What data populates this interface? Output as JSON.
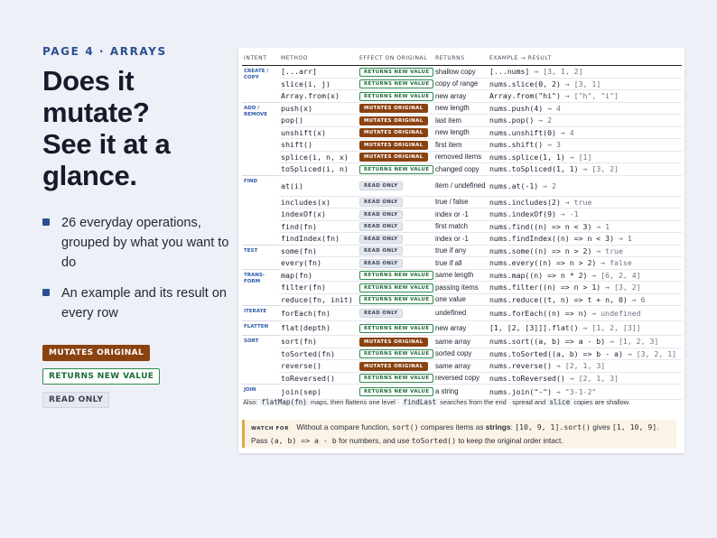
{
  "eyebrow": "PAGE 4 · ARRAYS",
  "title_lines": [
    "Does it mutate?",
    "See it at a",
    "glance."
  ],
  "bullets": [
    "26 everyday operations, grouped by what you want to do",
    "An example and its result on every row"
  ],
  "legend": {
    "mutates": "MUTATES ORIGINAL",
    "new_value": "RETURNS NEW VALUE",
    "read_only": "READ ONLY"
  },
  "colors": {
    "accent": "#2b4f92",
    "mutates": "#8a4210",
    "new_value": "#2f8a4f",
    "read_only": "#e3e7ef",
    "watch_border": "#e0a842",
    "watch_bg": "#fbf3e6"
  },
  "table": {
    "headers": [
      "INTENT",
      "METHOD",
      "EFFECT ON ORIGINAL",
      "RETURNS",
      "EXAMPLE → RESULT"
    ],
    "groups": [
      {
        "label": "CREATE / COPY",
        "rows": [
          {
            "method": "[...arr]",
            "effect": "new",
            "returns": "shallow copy",
            "example": "[...nums]",
            "result": "→ [3, 1, 2]"
          },
          {
            "method": "slice(i, j)",
            "effect": "new",
            "returns": "copy of range",
            "example": "nums.slice(0, 2)",
            "result": "→ [3, 1]"
          },
          {
            "method": "Array.from(x)",
            "effect": "new",
            "returns": "new array",
            "example": "Array.from(\"hi\")",
            "result": "→ [\"h\", \"i\"]"
          }
        ]
      },
      {
        "label": "ADD / REMOVE",
        "rows": [
          {
            "method": "push(x)",
            "effect": "mut",
            "returns": "new length",
            "example": "nums.push(4)",
            "result": "→ 4"
          },
          {
            "method": "pop()",
            "effect": "mut",
            "returns": "last item",
            "example": "nums.pop()",
            "result": "→ 2"
          },
          {
            "method": "unshift(x)",
            "effect": "mut",
            "returns": "new length",
            "example": "nums.unshift(0)",
            "result": "→ 4"
          },
          {
            "method": "shift()",
            "effect": "mut",
            "returns": "first item",
            "example": "nums.shift()",
            "result": "→ 3"
          },
          {
            "method": "splice(i, n, x)",
            "effect": "mut",
            "returns": "removed items",
            "example": "nums.splice(1, 1)",
            "result": "→ [1]"
          },
          {
            "method": "toSpliced(i, n)",
            "effect": "new",
            "returns": "changed copy",
            "example": "nums.toSpliced(1, 1)",
            "result": "→ [3, 2]"
          }
        ]
      },
      {
        "label": "FIND",
        "rows": [
          {
            "method": "at(i)",
            "effect": "ro",
            "returns": "item / undefined",
            "example": "nums.at(-1)",
            "result": "→ 2",
            "tall": true
          },
          {
            "method": "includes(x)",
            "effect": "ro",
            "returns": "true / false",
            "example": "nums.includes(2)",
            "result": "→ true"
          },
          {
            "method": "indexOf(x)",
            "effect": "ro",
            "returns": "index or -1",
            "example": "nums.indexOf(9)",
            "result": "→ -1"
          },
          {
            "method": "find(fn)",
            "effect": "ro",
            "returns": "first match",
            "example": "nums.find((n) => n < 3)",
            "result": "→ 1"
          },
          {
            "method": "findIndex(fn)",
            "effect": "ro",
            "returns": "index or -1",
            "example": "nums.findIndex((n) => n < 3)",
            "result": "→ 1"
          }
        ]
      },
      {
        "label": "TEST",
        "rows": [
          {
            "method": "some(fn)",
            "effect": "ro",
            "returns": "true if any",
            "example": "nums.some((n) => n > 2)",
            "result": "→ true"
          },
          {
            "method": "every(fn)",
            "effect": "ro",
            "returns": "true if all",
            "example": "nums.every((n) => n > 2)",
            "result": "→ false"
          }
        ]
      },
      {
        "label": "TRANS- FORM",
        "rows": [
          {
            "method": "map(fn)",
            "effect": "new",
            "returns": "same length",
            "example": "nums.map((n) => n * 2)",
            "result": "→ [6, 2, 4]"
          },
          {
            "method": "filter(fn)",
            "effect": "new",
            "returns": "passing items",
            "example": "nums.filter((n) => n > 1)",
            "result": "→ [3, 2]"
          },
          {
            "method": "reduce(fn, init)",
            "effect": "new",
            "returns": "one value",
            "example": "nums.reduce((t, n) => t + n, 0)",
            "result": "→ 6"
          }
        ]
      },
      {
        "label": "ITERATE",
        "rows": [
          {
            "method": "forEach(fn)",
            "effect": "ro",
            "returns": "undefined",
            "example": "nums.forEach((n) => n)",
            "result": "→ undefined"
          }
        ]
      },
      {
        "label": "FLATTEN",
        "rows": [
          {
            "method": "flat(depth)",
            "effect": "new",
            "returns": "new array",
            "example": "[1, [2, [3]]].flat()",
            "result": "→ [1, 2, [3]]"
          }
        ]
      },
      {
        "label": "SORT",
        "rows": [
          {
            "method": "sort(fn)",
            "effect": "mut",
            "returns": "same array",
            "example": "nums.sort((a, b) => a - b)",
            "result": "→ [1, 2, 3]"
          },
          {
            "method": "toSorted(fn)",
            "effect": "new",
            "returns": "sorted copy",
            "example": "nums.toSorted((a, b) => b - a)",
            "result": "→ [3, 2, 1]"
          },
          {
            "method": "reverse()",
            "effect": "mut",
            "returns": "same array",
            "example": "nums.reverse()",
            "result": "→ [2, 1, 3]"
          },
          {
            "method": "toReversed()",
            "effect": "new",
            "returns": "reversed copy",
            "example": "nums.toReversed()",
            "result": "→ [2, 1, 3]"
          }
        ]
      },
      {
        "label": "JOIN",
        "rows": [
          {
            "method": "join(sep)",
            "effect": "new",
            "returns": "a string",
            "example": "nums.join(\"-\")",
            "result": "→ \"3-1-2\""
          }
        ]
      }
    ]
  },
  "also": {
    "prefix": "Also:",
    "code1": "flatMap(fn)",
    "mid1": "maps, then flattens one level ·",
    "code2": "findLast",
    "mid2": "searches from the end · spread and",
    "code3": "slice",
    "suffix": "copies are shallow."
  },
  "watch": {
    "label": "WATCH FOR",
    "t1": "Without a compare function,",
    "c1": "sort()",
    "t2": "compares items as",
    "bold": "strings",
    "t3": ":",
    "c2": "[10, 9, 1].sort()",
    "t4": "gives",
    "c3": "[1, 10, 9]",
    "t5": ". Pass",
    "c4": "(a, b) => a - b",
    "t6": "for numbers, and use",
    "c5": "toSorted()",
    "t7": "to keep the original order intact."
  }
}
